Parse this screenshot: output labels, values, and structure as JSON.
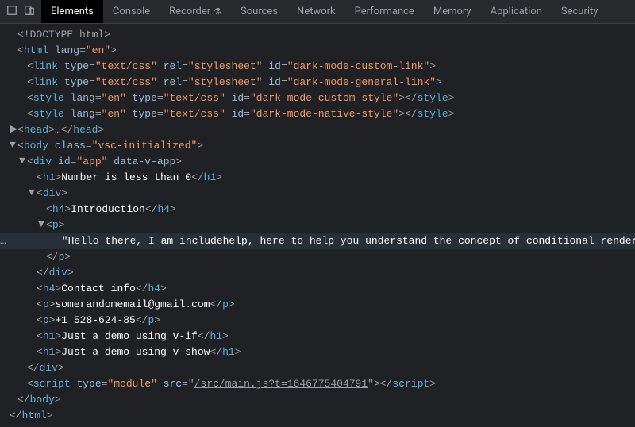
{
  "tabs": {
    "elements": "Elements",
    "console": "Console",
    "recorder": "Recorder",
    "sources": "Sources",
    "network": "Network",
    "performance": "Performance",
    "memory": "Memory",
    "application": "Application",
    "security": "Security"
  },
  "dom": {
    "doctype": "<!DOCTYPE html>",
    "html_open_tag": "html",
    "html_lang_attr": "lang",
    "html_lang_val": "\"en\"",
    "link": {
      "tag": "link",
      "type_attr": "type",
      "type_val": "\"text/css\"",
      "rel_attr": "rel",
      "rel_val": "\"stylesheet\"",
      "id_attr": "id",
      "id_val_1": "\"dark-mode-custom-link\"",
      "id_val_2": "\"dark-mode-general-link\""
    },
    "style": {
      "tag": "style",
      "lang_attr": "lang",
      "lang_val": "\"en\"",
      "type_attr": "type",
      "type_val": "\"text/css\"",
      "id_attr": "id",
      "id_val_1": "\"dark-mode-custom-style\"",
      "id_val_2": "\"dark-mode-native-style\""
    },
    "head_tag": "head",
    "body_tag": "body",
    "body_class_attr": "class",
    "body_class_val": "\"vsc-initialized\"",
    "div_tag": "div",
    "div_id_attr": "id",
    "div_id_val": "\"app\"",
    "div_data_attr": "data-v-app",
    "h1_tag": "h1",
    "h1_text": "Number is less than 0",
    "h4_tag": "h4",
    "h4_text_intro": "Introduction",
    "p_tag": "p",
    "p_long_text": " \"Hello there, I am includehelp, here to help you understand the concept of conditional rendering.\" ",
    "h4_contact": "Contact info",
    "p_email": "somerandomemail@gmail.com",
    "p_phone": "+1 528-624-85",
    "h1_vif": "Just a demo using v-if",
    "h1_vshow": "Just a demo using v-show",
    "script_tag": "script",
    "script_type_attr": "type",
    "script_type_val": "\"module\"",
    "script_src_attr": "src",
    "script_src_val": "/src/main.js?t=1646775404791",
    "eq_marker": "=="
  }
}
